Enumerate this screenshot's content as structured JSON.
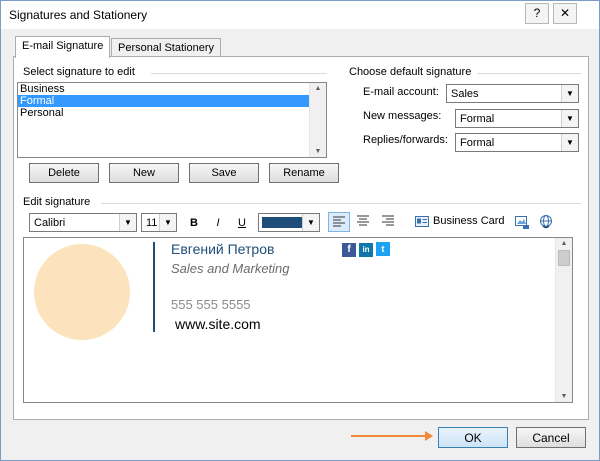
{
  "window": {
    "title": "Signatures and Stationery",
    "help_icon": "?",
    "close_icon": "✕"
  },
  "tabs": [
    {
      "label": "E-mail Signature",
      "active": true
    },
    {
      "label": "Personal Stationery",
      "active": false
    }
  ],
  "select_group": {
    "label": "Select signature to edit",
    "items": [
      "Business",
      "Formal",
      "Personal"
    ],
    "selected": "Formal"
  },
  "buttons": {
    "delete": "Delete",
    "new": "New",
    "save": "Save",
    "rename": "Rename"
  },
  "default_group": {
    "label": "Choose default signature",
    "email_account_label": "E-mail account:",
    "email_account_value": "Sales",
    "new_messages_label": "New messages:",
    "new_messages_value": "Formal",
    "replies_label": "Replies/forwards:",
    "replies_value": "Formal"
  },
  "edit_group": {
    "label": "Edit signature",
    "font": "Calibri",
    "size": "11",
    "bold": "B",
    "italic": "I",
    "underline": "U",
    "font_color": "#1f4e79",
    "business_card": "Business Card"
  },
  "signature": {
    "name": "Евгений Петров",
    "title": "Sales and Marketing",
    "phone": "555 555 5555",
    "website": "www.site.com",
    "social": [
      "f",
      "in",
      "t"
    ],
    "avatar_color": "#fde3bd",
    "accent_color": "#1f4e79"
  },
  "footer": {
    "ok": "OK",
    "cancel": "Cancel"
  }
}
